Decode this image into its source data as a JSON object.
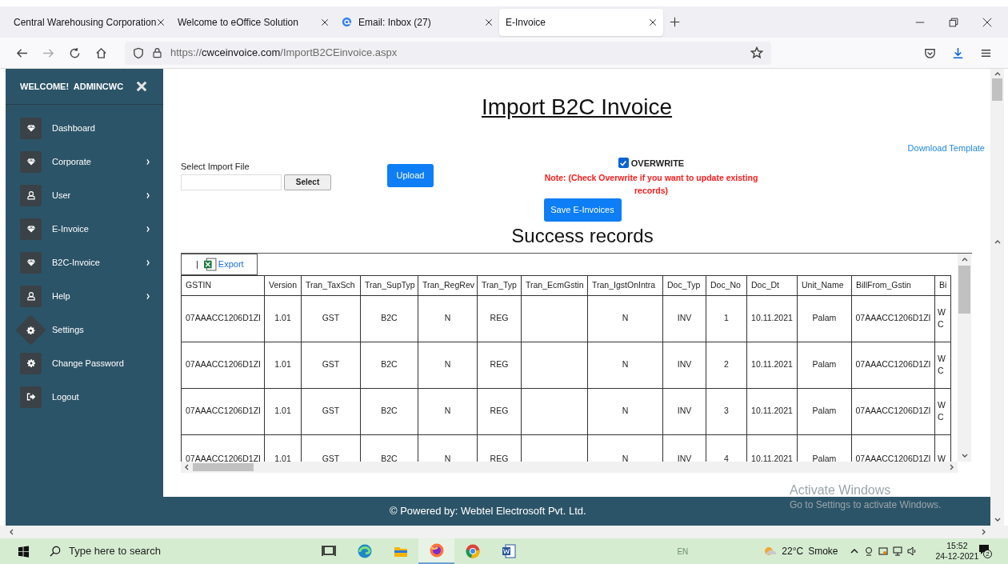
{
  "browser": {
    "tabs": [
      {
        "label": "Central Warehousing Corporation",
        "selected": false,
        "kind": "plain"
      },
      {
        "label": "Welcome to eOffice Solution",
        "selected": false,
        "kind": "plain"
      },
      {
        "label": "Email: Inbox (27)",
        "selected": false,
        "kind": "mail"
      },
      {
        "label": "E-Invoice",
        "selected": true,
        "kind": "plain"
      }
    ],
    "url_prefix": "https://",
    "url_domain": "cwceinvoice.com",
    "url_path": "/ImportB2CEinvoice.aspx"
  },
  "sidebar": {
    "welcome": "WELCOME!  ADMINCWC",
    "items": [
      {
        "label": "Dashboard",
        "kind": "diamond",
        "submenu": false,
        "hovered": false
      },
      {
        "label": "Corporate",
        "kind": "diamond",
        "submenu": true,
        "hovered": false
      },
      {
        "label": "User",
        "kind": "user",
        "submenu": true,
        "hovered": false
      },
      {
        "label": "E-Invoice",
        "kind": "diamond",
        "submenu": true,
        "hovered": false
      },
      {
        "label": "B2C-Invoice",
        "kind": "diamond",
        "submenu": true,
        "hovered": false
      },
      {
        "label": "Help",
        "kind": "user",
        "submenu": true,
        "hovered": false
      },
      {
        "label": "Settings",
        "kind": "gear",
        "submenu": false,
        "hovered": true
      },
      {
        "label": "Change Password",
        "kind": "gear",
        "submenu": false,
        "hovered": false
      },
      {
        "label": "Logout",
        "kind": "logout",
        "submenu": false,
        "hovered": false
      }
    ]
  },
  "main": {
    "title": "Import B2C Invoice",
    "download_link": "Download Template",
    "file_label": "Select Import File",
    "select_button": "Select",
    "upload_button": "Upload",
    "overwrite": {
      "label": "OVERWRITE",
      "checked": true
    },
    "note": "Note: (Check Overwrite if you want to update existing records)",
    "save_button": "Save E-Invoices",
    "section_title": "Success records",
    "export_separator": "|",
    "export_label": "Export",
    "table": {
      "columns": [
        "GSTIN",
        "Version",
        "Tran_TaxSch",
        "Tran_SupTyp",
        "Tran_RegRev",
        "Tran_Typ",
        "Tran_EcmGstin",
        "Tran_IgstOnIntra",
        "Doc_Typ",
        "Doc_No",
        "Doc_Dt",
        "Unit_Name",
        "BillFrom_Gstin",
        "Bi"
      ],
      "rows": [
        [
          "07AAACC1206D1ZI",
          "1.01",
          "GST",
          "B2C",
          "N",
          "REG",
          "",
          "N",
          "INV",
          "1",
          "10.11.2021",
          "Palam",
          "07AAACC1206D1ZI",
          "W C"
        ],
        [
          "07AAACC1206D1ZI",
          "1.01",
          "GST",
          "B2C",
          "N",
          "REG",
          "",
          "N",
          "INV",
          "2",
          "10.11.2021",
          "Palam",
          "07AAACC1206D1ZI",
          "W C"
        ],
        [
          "07AAACC1206D1ZI",
          "1.01",
          "GST",
          "B2C",
          "N",
          "REG",
          "",
          "N",
          "INV",
          "3",
          "10.11.2021",
          "Palam",
          "07AAACC1206D1ZI",
          "W C"
        ],
        [
          "07AAACC1206D1ZI",
          "1.01",
          "GST",
          "B2C",
          "N",
          "REG",
          "",
          "N",
          "INV",
          "4",
          "10.11.2021",
          "Palam",
          "07AAACC1206D1ZI",
          "W"
        ]
      ]
    }
  },
  "footer": "© Powered by: Webtel Electrosoft Pvt. Ltd.",
  "activation": {
    "title": "Activate Windows",
    "subtitle": "Go to Settings to activate Windows."
  },
  "taskbar": {
    "search_placeholder": "Type here to search",
    "language": "EN",
    "temperature": "22°C",
    "weather": "Smoke",
    "time": "15:52",
    "date": "24-12-2021",
    "notifications": "2"
  }
}
